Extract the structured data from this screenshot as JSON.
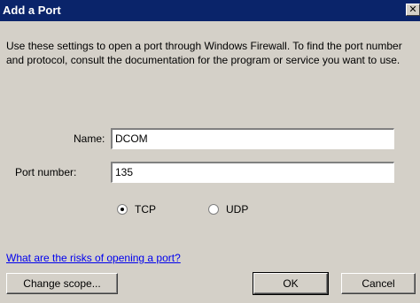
{
  "dialog": {
    "title": "Add a Port",
    "close_glyph": "✕",
    "description": "Use these settings to open a port through Windows Firewall. To find the port number and protocol, consult the documentation for the program or service you want to use."
  },
  "form": {
    "name_label": "Name:",
    "name_value": "DCOM",
    "port_label": "Port number:",
    "port_value": "135",
    "protocol": {
      "options": [
        "TCP",
        "UDP"
      ],
      "selected": "TCP"
    }
  },
  "help_link": "What are the risks of opening a port?",
  "buttons": {
    "change_scope": "Change scope...",
    "ok": "OK",
    "cancel": "Cancel"
  },
  "colors": {
    "titlebar": "#0a246a",
    "dialog_bg": "#d4d0c8",
    "link": "#0000ee"
  }
}
